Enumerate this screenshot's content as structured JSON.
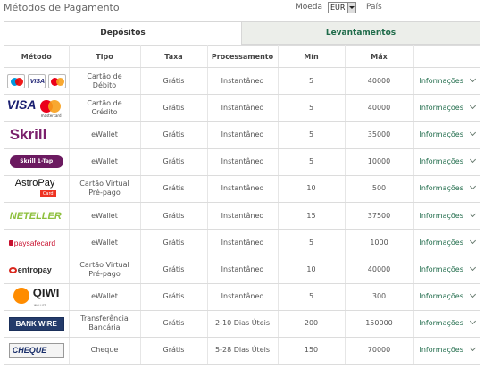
{
  "header": {
    "title": "Métodos de Pagamento",
    "currency_label": "Moeda",
    "currency_value": "EUR",
    "country_label": "País"
  },
  "tabs": [
    {
      "label": "Depósitos",
      "active": true
    },
    {
      "label": "Levantamentos",
      "active": false
    }
  ],
  "columns": [
    "Método",
    "Tipo",
    "Taxa",
    "Processamento",
    "Mín",
    "Máx",
    ""
  ],
  "rows": [
    {
      "method": "Cartão de Débito logos",
      "logo": "debit-cards",
      "tipo": "Cartão de Débito",
      "taxa": "Grátis",
      "proc": "Instantâneo",
      "min": "5",
      "max": "40000",
      "info": "Informações"
    },
    {
      "method": "VISA",
      "logo": "visa-mastercard",
      "tipo": "Cartão de Crédito",
      "taxa": "Grátis",
      "proc": "Instantâneo",
      "min": "5",
      "max": "40000",
      "info": "Informações"
    },
    {
      "method": "Skrill",
      "logo": "skrill",
      "tipo": "eWallet",
      "taxa": "Grátis",
      "proc": "Instantâneo",
      "min": "5",
      "max": "35000",
      "info": "Informações"
    },
    {
      "method": "Skrill 1-Tap",
      "logo": "skrill-1tap",
      "tipo": "eWallet",
      "taxa": "Grátis",
      "proc": "Instantâneo",
      "min": "5",
      "max": "10000",
      "info": "Informações"
    },
    {
      "method": "AstroPay",
      "logo": "astropay",
      "tipo": "Cartão Virtual Pré-pago",
      "taxa": "Grátis",
      "proc": "Instantâneo",
      "min": "10",
      "max": "500",
      "info": "Informações"
    },
    {
      "method": "NETELLER",
      "logo": "neteller",
      "tipo": "eWallet",
      "taxa": "Grátis",
      "proc": "Instantâneo",
      "min": "15",
      "max": "37500",
      "info": "Informações"
    },
    {
      "method": "paysafecard",
      "logo": "paysafecard",
      "tipo": "eWallet",
      "taxa": "Grátis",
      "proc": "Instantâneo",
      "min": "5",
      "max": "1000",
      "info": "Informações"
    },
    {
      "method": "entropay",
      "logo": "entropay",
      "tipo": "Cartão Virtual Pré-pago",
      "taxa": "Grátis",
      "proc": "Instantâneo",
      "min": "10",
      "max": "40000",
      "info": "Informações"
    },
    {
      "method": "QIWI",
      "logo": "qiwi",
      "tipo": "eWallet",
      "taxa": "Grátis",
      "proc": "Instantâneo",
      "min": "5",
      "max": "300",
      "info": "Informações"
    },
    {
      "method": "BANK WIRE",
      "logo": "bank-wire",
      "tipo": "Transferência Bancária",
      "taxa": "Grátis",
      "proc": "2-10 Dias Úteis",
      "min": "200",
      "max": "150000",
      "info": "Informações"
    },
    {
      "method": "CHEQUE",
      "logo": "cheque",
      "tipo": "Cheque",
      "taxa": "Grátis",
      "proc": "5-28 Dias Úteis",
      "min": "150",
      "max": "70000",
      "info": "Informações"
    }
  ],
  "logo_text": {
    "visa": "VISA",
    "mastercard": "mastercard",
    "skrill": "Skrill",
    "skrill1tap": "Skrill 1-Tap",
    "astropay": "AstroPay",
    "astropay_card": "Card",
    "neteller": "NETELLER",
    "paysafecard": "paysafecard",
    "entropay": "entropay",
    "qiwi": "QIWI",
    "qiwi_sub": "WALLET",
    "bankwire": "BANK WIRE",
    "cheque": "CHEQUE"
  },
  "colors": {
    "accent_green": "#1f6b4a",
    "inactive_tab_bg": "#eceeea",
    "skrill_purple": "#7a1f6b",
    "neteller_green": "#8dbf3c",
    "paysafe_red": "#c8102e",
    "qiwi_orange": "#ff8c00",
    "visa_blue": "#1a1f71"
  }
}
